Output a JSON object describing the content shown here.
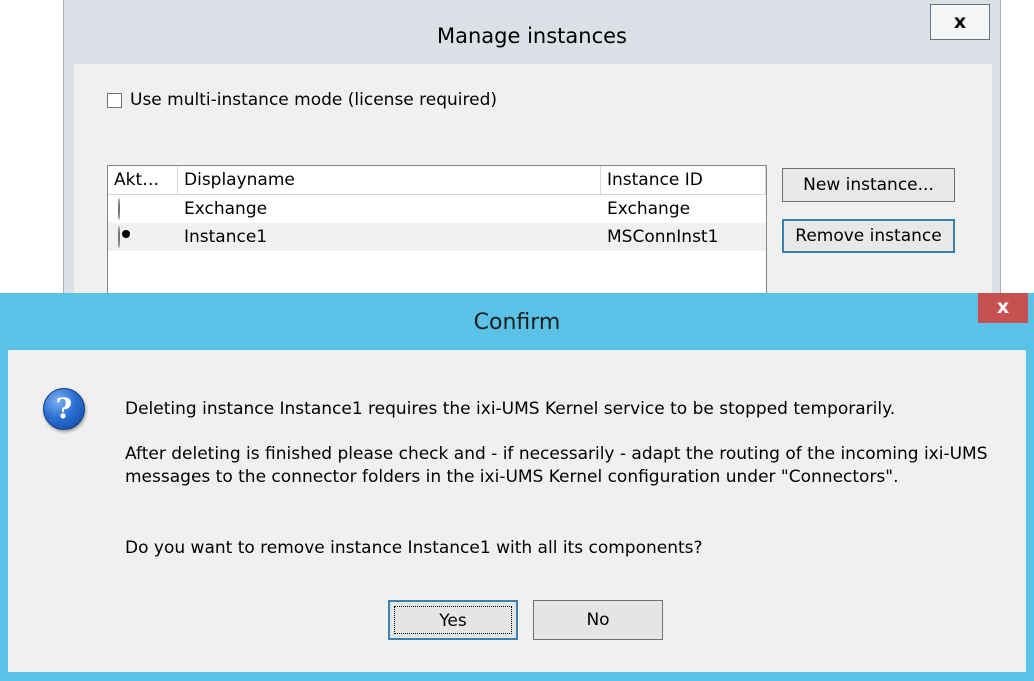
{
  "manage_window": {
    "title": "Manage instances",
    "close_label": "x",
    "multi_instance_checkbox": {
      "label": "Use multi-instance mode (license required)",
      "checked": false
    },
    "list": {
      "columns": [
        "Akt…",
        "Displayname",
        "Instance ID"
      ],
      "rows": [
        {
          "active": false,
          "displayname": "Exchange",
          "instance_id": "Exchange"
        },
        {
          "active": true,
          "displayname": "Instance1",
          "instance_id": "MSConnInst1"
        }
      ]
    },
    "buttons": {
      "new_instance": "New instance...",
      "remove_instance": "Remove instance"
    }
  },
  "confirm_dialog": {
    "title": "Confirm",
    "close_label": "x",
    "icon": "question-icon",
    "message_1": "Deleting instance Instance1 requires the ixi-UMS Kernel service to be stopped temporarily.",
    "message_2": "After deleting is finished please check and - if necessarily - adapt the routing of the incoming ixi-UMS messages to the connector folders in the ixi-UMS Kernel configuration under \"Connectors\".",
    "message_3": "Do you want to remove instance Instance1 with all its components?",
    "yes_label": "Yes",
    "no_label": "No",
    "accent_color": "#5bc2e7",
    "close_color": "#c75050"
  }
}
